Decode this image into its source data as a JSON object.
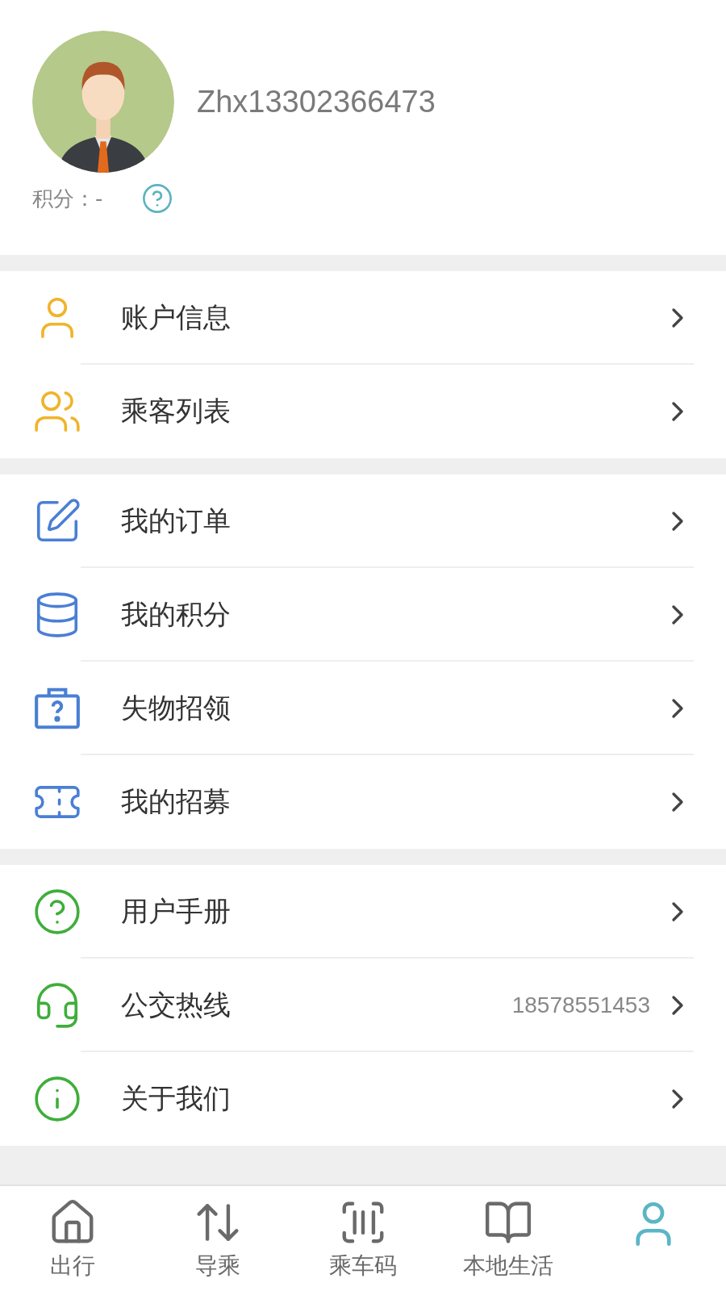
{
  "profile": {
    "username": "Zhx13302366473",
    "points_label": "积分：",
    "points_value": "-"
  },
  "menu_groups": [
    {
      "items": [
        {
          "kind": "user",
          "color": "#f0b429",
          "label": "账户信息"
        },
        {
          "kind": "users",
          "color": "#f0b429",
          "label": "乘客列表"
        }
      ]
    },
    {
      "items": [
        {
          "kind": "order",
          "color": "#4a7fd4",
          "label": "我的订单"
        },
        {
          "kind": "database",
          "color": "#4a7fd4",
          "label": "我的积分"
        },
        {
          "kind": "lost",
          "color": "#4a7fd4",
          "label": "失物招领"
        },
        {
          "kind": "ticket",
          "color": "#4a7fd4",
          "label": "我的招募"
        }
      ]
    },
    {
      "items": [
        {
          "kind": "help",
          "color": "#3fae3a",
          "label": "用户手册"
        },
        {
          "kind": "headset",
          "color": "#3fae3a",
          "label": "公交热线",
          "value": "18578551453"
        },
        {
          "kind": "info",
          "color": "#3fae3a",
          "label": "关于我们"
        }
      ]
    }
  ],
  "tab_bar": [
    {
      "kind": "home",
      "label": "出行",
      "selected": false
    },
    {
      "kind": "transfer",
      "label": "导乘",
      "selected": false
    },
    {
      "kind": "barcode",
      "label": "乘车码",
      "selected": false
    },
    {
      "kind": "book",
      "label": "本地生活",
      "selected": false
    },
    {
      "kind": "person",
      "selected": true
    }
  ]
}
